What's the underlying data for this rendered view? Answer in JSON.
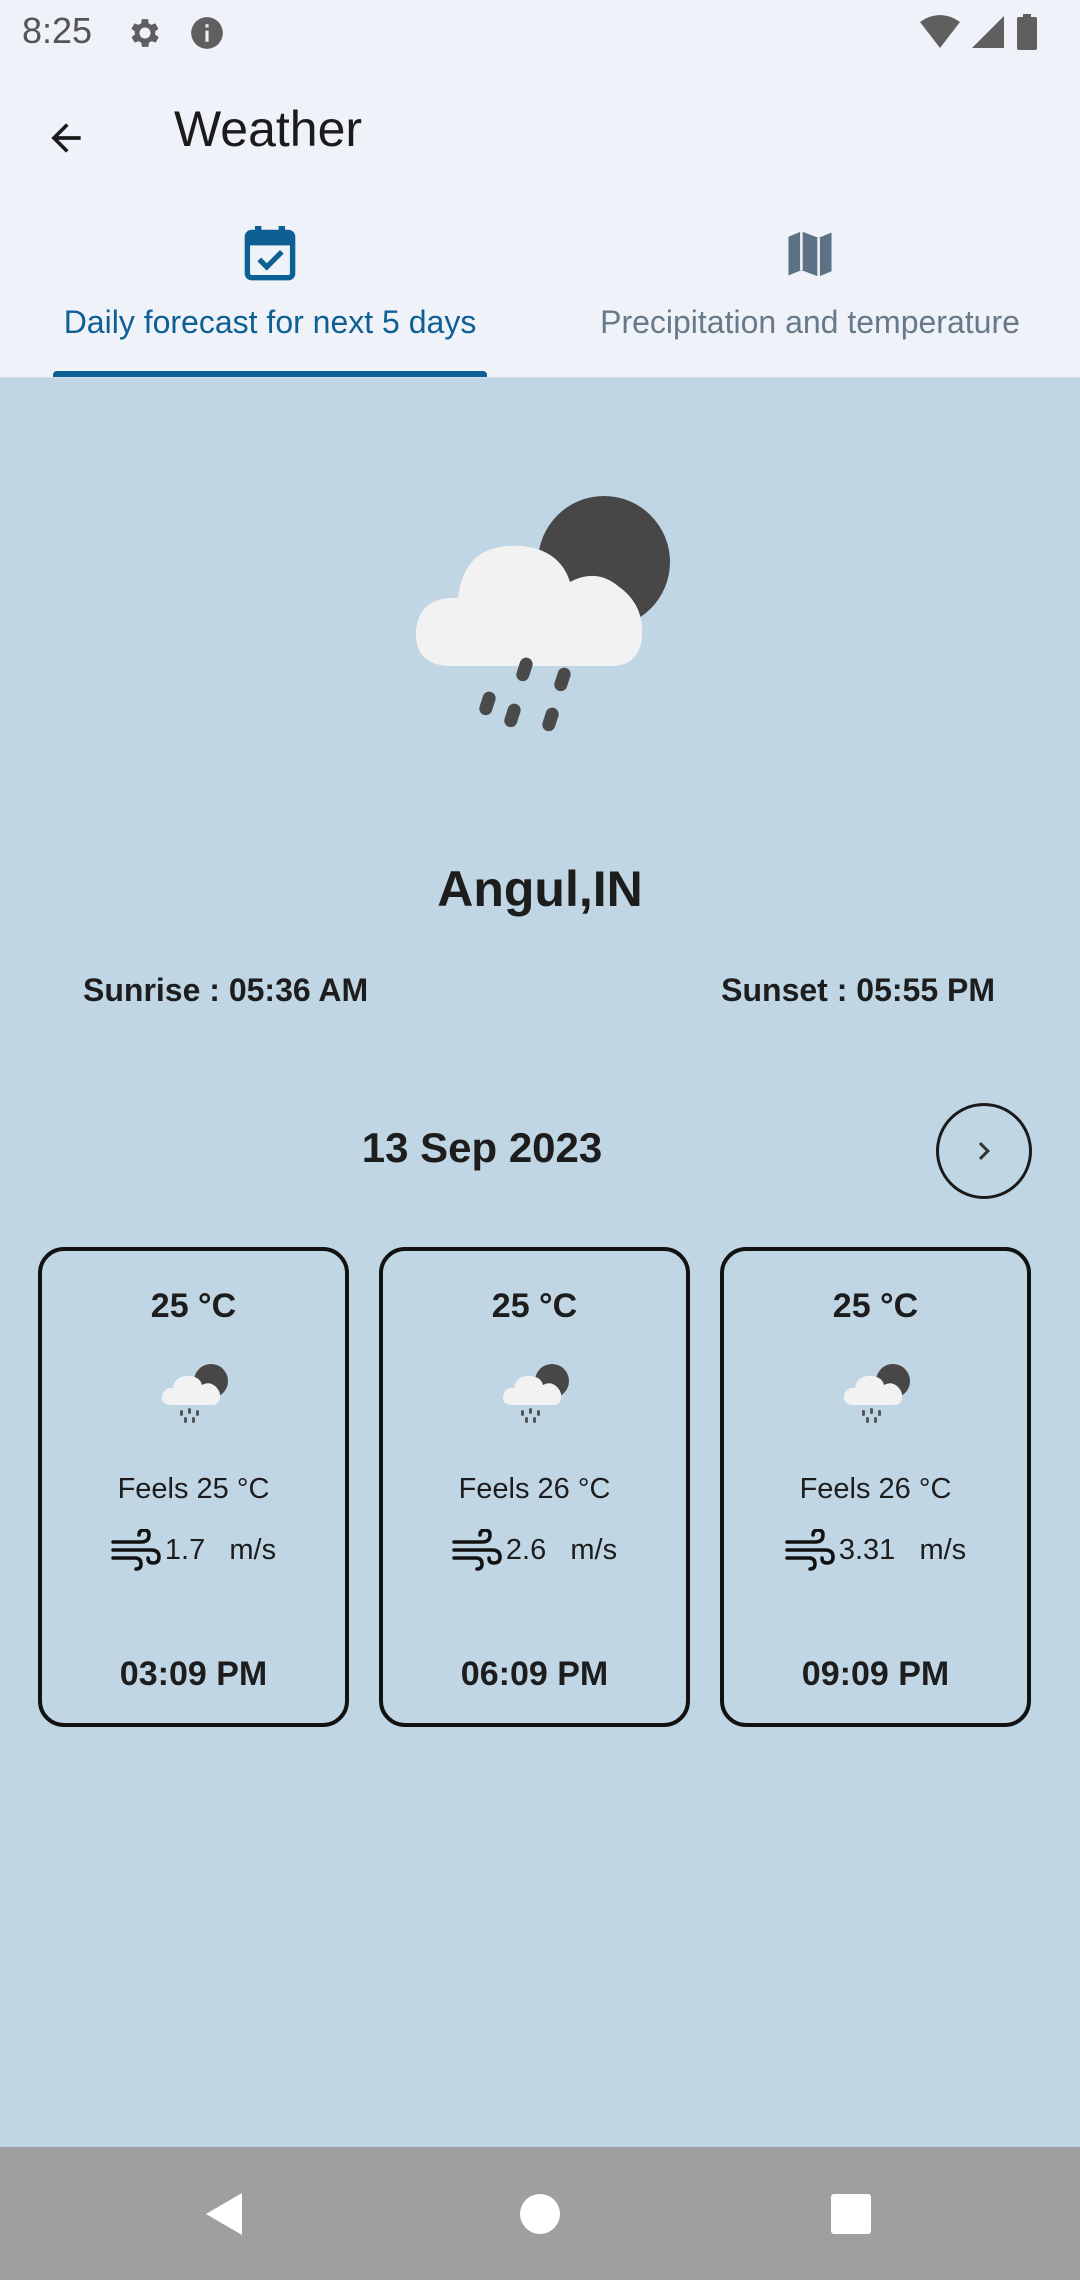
{
  "status_bar": {
    "time": "8:25",
    "icons": [
      "settings-icon",
      "info-icon",
      "wifi-icon",
      "signal-icon",
      "battery-icon"
    ]
  },
  "app_bar": {
    "title": "Weather",
    "back_icon": "arrow-back-icon"
  },
  "tabs": [
    {
      "label": "Daily forecast for next 5 days",
      "icon": "calendar-check-icon",
      "selected": true
    },
    {
      "label": "Precipitation and temperature",
      "icon": "map-icon",
      "selected": false
    }
  ],
  "weather": {
    "icon": "rain-cloud-night-icon",
    "location": "Angul,IN",
    "sunrise": "Sunrise : 05:36 AM",
    "sunset": "Sunset : 05:55 PM",
    "date": "13 Sep 2023",
    "next_icon": "chevron-right-icon"
  },
  "forecast": [
    {
      "temp": "25 °C",
      "feels": "Feels 25  °C",
      "wind": "1.7   m/s",
      "time": "03:09 PM"
    },
    {
      "temp": "25 °C",
      "feels": "Feels 26  °C",
      "wind": "2.6   m/s",
      "time": "06:09 PM"
    },
    {
      "temp": "25 °C",
      "feels": "Feels 26  °C",
      "wind": "3.31   m/s",
      "time": "09:09 PM"
    }
  ],
  "colors": {
    "accent": "#0d5f94",
    "background": "#c0d6e4",
    "header_bg": "#eff2f8",
    "nav_bar": "#9f9f9f"
  },
  "nav_bar": [
    "back-triangle-icon",
    "home-circle-icon",
    "recents-square-icon"
  ]
}
